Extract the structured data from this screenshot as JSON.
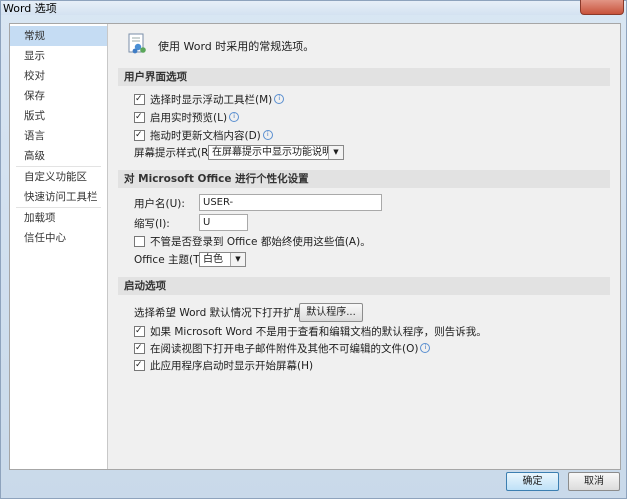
{
  "window": {
    "title": "Word 选项"
  },
  "sidebar": {
    "items": [
      {
        "label": "常规"
      },
      {
        "label": "显示"
      },
      {
        "label": "校对"
      },
      {
        "label": "保存"
      },
      {
        "label": "版式"
      },
      {
        "label": "语言"
      },
      {
        "label": "高级"
      },
      {
        "label": "自定义功能区"
      },
      {
        "label": "快速访问工具栏"
      },
      {
        "label": "加载项"
      },
      {
        "label": "信任中心"
      }
    ]
  },
  "header": {
    "text": "使用 Word 时采用的常规选项。"
  },
  "ui_section": {
    "title": "用户界面选项",
    "show_mini_toolbar": "选择时显示浮动工具栏(M)",
    "live_preview": "启用实时预览(L)",
    "drag_update": "拖动时更新文档内容(D)",
    "screentip_label": "屏幕提示样式(R):",
    "screentip_value": "在屏幕提示中显示功能说明"
  },
  "personalize_section": {
    "title": "对 Microsoft Office 进行个性化设置",
    "username_label": "用户名(U):",
    "username_value": "USER-",
    "initials_label": "缩写(I):",
    "initials_value": "U",
    "always_use_label": "不管是否登录到 Office 都始终使用这些值(A)。",
    "theme_label": "Office 主题(T):",
    "theme_value": "白色"
  },
  "startup_section": {
    "title": "启动选项",
    "default_ext_label": "选择希望 Word 默认情况下打开扩展名:",
    "default_programs_button": "默认程序...",
    "tell_me_label": "如果 Microsoft Word 不是用于查看和编辑文档的默认程序，则告诉我。",
    "open_attachments_label": "在阅读视图下打开电子邮件附件及其他不可编辑的文件(O)",
    "show_start_label": "此应用程序启动时显示开始屏幕(H)"
  },
  "footer": {
    "ok": "确定",
    "cancel": "取消"
  }
}
